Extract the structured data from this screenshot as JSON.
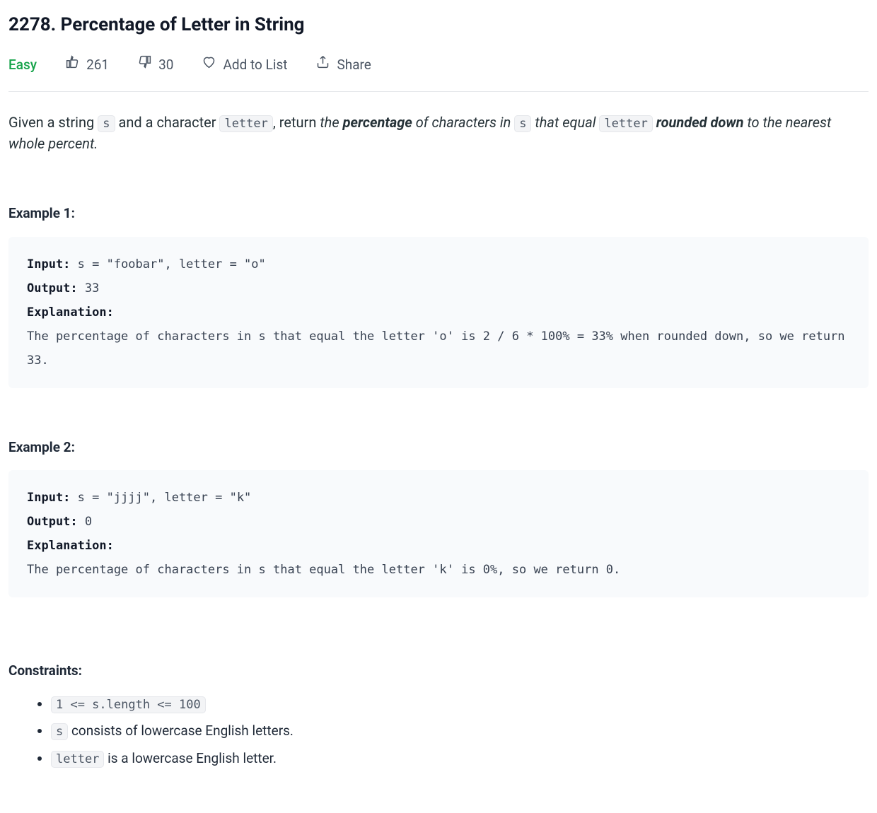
{
  "title": "2278. Percentage of Letter in String",
  "meta": {
    "difficulty": "Easy",
    "likes": "261",
    "dislikes": "30",
    "add_to_list": "Add to List",
    "share": "Share"
  },
  "desc": {
    "p1_a": "Given a string ",
    "p1_code_s": "s",
    "p1_b": " and a character ",
    "p1_code_letter": "letter",
    "p1_c": ", return ",
    "p1_italic_a": "the ",
    "p1_bold_pct": "percentage",
    "p1_italic_b": " of characters in ",
    "p1_code_s2": "s",
    "p1_italic_c": " that equal ",
    "p1_code_letter2": "letter",
    "p1_bold_rounded": " rounded down",
    "p1_italic_d": " to the nearest whole percent."
  },
  "examples": [
    {
      "heading": "Example 1:",
      "input_label": "Input:",
      "input_value": " s = \"foobar\", letter = \"o\"",
      "output_label": "Output:",
      "output_value": " 33",
      "explanation_label": "Explanation:",
      "explanation_text": "The percentage of characters in s that equal the letter 'o' is 2 / 6 * 100% = 33% when rounded down, so we return 33."
    },
    {
      "heading": "Example 2:",
      "input_label": "Input:",
      "input_value": " s = \"jjjj\", letter = \"k\"",
      "output_label": "Output:",
      "output_value": " 0",
      "explanation_label": "Explanation:",
      "explanation_text": "The percentage of characters in s that equal the letter 'k' is 0%, so we return 0."
    }
  ],
  "constraints": {
    "heading": "Constraints:",
    "items": [
      {
        "code": "1 <= s.length <= 100",
        "text": ""
      },
      {
        "code": "s",
        "text": " consists of lowercase English letters."
      },
      {
        "code": "letter",
        "text": " is a lowercase English letter."
      }
    ]
  }
}
